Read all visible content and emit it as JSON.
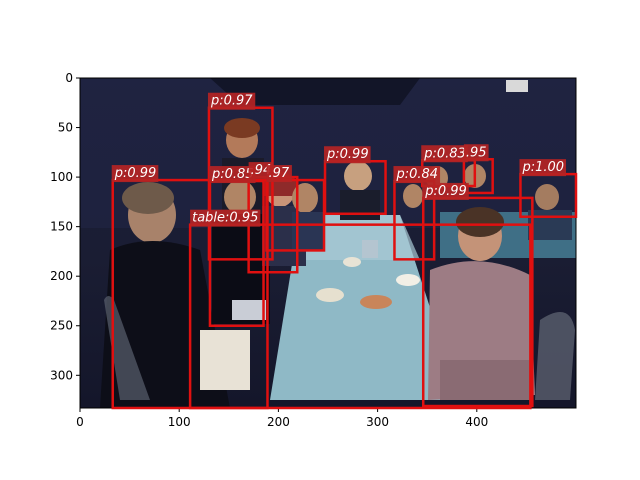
{
  "chart_data": {
    "type": "image-detections",
    "x_ticks": [
      "0",
      "100",
      "200",
      "300",
      "400"
    ],
    "y_ticks": [
      "0",
      "50",
      "100",
      "150",
      "200",
      "250",
      "300"
    ],
    "xlim": [
      0,
      500
    ],
    "ylim": [
      0,
      333
    ],
    "box_color": "#e01010",
    "label_bg": "#b42424",
    "detections": [
      {
        "label": "p:0.99",
        "x0": 33,
        "y0": 103,
        "x1": 189,
        "y1": 333
      },
      {
        "label": "p:0.97",
        "x0": 130,
        "y0": 30,
        "x1": 194,
        "y1": 183
      },
      {
        "label": "p:0.85",
        "x0": 131,
        "y0": 104,
        "x1": 185,
        "y1": 250
      },
      {
        "label": ".94",
        "x0": 170,
        "y0": 100,
        "x1": 219,
        "y1": 196
      },
      {
        "label": ".97",
        "x0": 188,
        "y0": 103,
        "x1": 246,
        "y1": 174
      },
      {
        "label": "p:0.99",
        "x0": 247,
        "y0": 84,
        "x1": 308,
        "y1": 137
      },
      {
        "label": "p:0.84",
        "x0": 317,
        "y0": 104,
        "x1": 357,
        "y1": 183
      },
      {
        "label": "p:0.83",
        "x0": 345,
        "y0": 83,
        "x1": 398,
        "y1": 109
      },
      {
        "label": ".95",
        "x0": 387,
        "y0": 82,
        "x1": 416,
        "y1": 116
      },
      {
        "label": "p:0.99",
        "x0": 346,
        "y0": 121,
        "x1": 456,
        "y1": 331
      },
      {
        "label": "p:1.00",
        "x0": 444,
        "y0": 97,
        "x1": 500,
        "y1": 140
      },
      {
        "label": "table:0.95",
        "x0": 111,
        "y0": 148,
        "x1": 454,
        "y1": 333
      }
    ]
  }
}
